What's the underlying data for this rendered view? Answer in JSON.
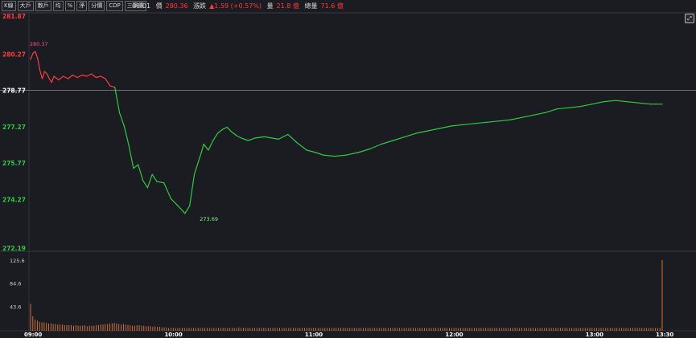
{
  "toolbar": {
    "buttons": [
      "K線",
      "大戶",
      "散戶",
      "均",
      "%",
      "淨",
      "分價",
      "CDP",
      "三筆價"
    ]
  },
  "info": {
    "time": "09:01",
    "price_label": "價",
    "price_value": "280.36",
    "change_label": "漲跌",
    "change_value": "▲1.59 (+0.57%)",
    "volume_label": "量",
    "volume_value": "21.8 億",
    "total_volume_label": "總量",
    "total_volume_value": "71.6 億"
  },
  "colors": {
    "up": "#ff3b3b",
    "down": "#2ecc40",
    "reference": "#ffffff",
    "volume": "#e07a3a",
    "high_label": "#ff4fa0",
    "low_label": "#7dff7d"
  },
  "icons": {
    "zoom": "expand-icon"
  },
  "chart_data": [
    {
      "type": "line",
      "reference_price": 278.77,
      "ylim": [
        272.19,
        281.87
      ],
      "y_ticks": [
        "281.87",
        "280.27",
        "278.77",
        "277.27",
        "275.77",
        "274.27",
        "272.19"
      ],
      "x_ticks": [
        "09:00",
        "10:00",
        "11:00",
        "12:00",
        "13:00",
        "13:30"
      ],
      "annotations": [
        {
          "text": "280.37",
          "x": "09:01",
          "y": 280.37
        },
        {
          "text": "273.69",
          "x": "10:13",
          "y": 273.69
        }
      ],
      "series": [
        {
          "x": [
            "09:00",
            "09:01",
            "09:02",
            "09:03",
            "09:04",
            "09:05",
            "09:06",
            "09:07",
            "09:08",
            "09:09",
            "09:10",
            "09:12",
            "09:14",
            "09:16",
            "09:18",
            "09:20",
            "09:22",
            "09:24",
            "09:26",
            "09:28",
            "09:30",
            "09:32",
            "09:34",
            "09:36",
            "09:38",
            "09:40",
            "09:42",
            "09:44",
            "09:46",
            "09:48",
            "09:50",
            "09:52",
            "09:54",
            "09:57",
            "10:00",
            "10:03",
            "10:06",
            "10:08",
            "10:10",
            "10:12",
            "10:13",
            "10:14",
            "10:16",
            "10:18",
            "10:20",
            "10:22",
            "10:24",
            "10:26",
            "10:28",
            "10:30",
            "10:33",
            "10:36",
            "10:40",
            "10:43",
            "10:46",
            "10:50",
            "10:54",
            "10:58",
            "11:00",
            "11:02",
            "11:05",
            "11:10",
            "11:15",
            "11:20",
            "11:25",
            "11:30",
            "11:35",
            "11:40",
            "11:45",
            "11:50",
            "11:55",
            "12:00",
            "12:05",
            "12:10",
            "12:15",
            "12:20",
            "12:25",
            "12:30",
            "12:35",
            "12:40",
            "12:45",
            "12:50",
            "12:55",
            "13:00",
            "13:05",
            "13:10",
            "13:15",
            "13:20",
            "13:25",
            "13:27",
            "13:30"
          ],
          "values": [
            280.05,
            280.3,
            280.37,
            280.1,
            279.6,
            279.25,
            279.55,
            279.45,
            279.25,
            279.1,
            279.35,
            279.2,
            279.35,
            279.25,
            279.4,
            279.3,
            279.4,
            279.35,
            279.45,
            279.3,
            279.35,
            279.25,
            278.95,
            278.9,
            277.85,
            277.3,
            276.5,
            275.55,
            275.7,
            275.05,
            274.75,
            275.3,
            275.0,
            274.95,
            274.3,
            274.0,
            273.69,
            274.0,
            275.3,
            275.9,
            276.2,
            276.55,
            276.3,
            276.7,
            277.0,
            277.15,
            277.25,
            277.05,
            276.9,
            276.8,
            276.7,
            276.8,
            276.85,
            276.8,
            276.75,
            276.95,
            276.6,
            276.3,
            276.25,
            276.2,
            276.1,
            276.05,
            276.1,
            276.2,
            276.35,
            276.55,
            276.7,
            276.85,
            277.0,
            277.1,
            277.2,
            277.3,
            277.35,
            277.4,
            277.45,
            277.5,
            277.55,
            277.65,
            277.75,
            277.85,
            278.0,
            278.05,
            278.1,
            278.2,
            278.3,
            278.35,
            278.3,
            278.25,
            278.2,
            278.2,
            278.2
          ]
        }
      ]
    },
    {
      "type": "bar",
      "ylim": [
        0,
        125.6
      ],
      "y_ticks": [
        "125.6",
        "84.6",
        "43.6"
      ],
      "categories_note": "per-minute volume",
      "values": [
        48,
        26,
        20,
        18,
        16,
        15,
        15,
        14,
        13,
        13,
        12,
        12,
        11,
        11,
        11,
        10,
        10,
        10,
        10,
        9,
        10,
        9,
        9,
        9,
        10,
        8,
        9,
        9,
        9,
        10,
        10,
        11,
        11,
        12,
        12,
        13,
        13,
        14,
        13,
        12,
        11,
        12,
        11,
        10,
        10,
        9,
        9,
        10,
        10,
        9,
        9,
        8,
        8,
        8,
        7,
        8,
        7,
        7,
        6,
        6,
        6,
        5,
        5,
        5,
        5,
        5,
        5,
        5,
        5,
        5,
        5,
        5,
        5,
        5,
        5,
        5,
        5,
        5,
        5,
        5,
        5,
        5,
        5,
        5,
        5,
        5,
        5,
        5,
        5,
        5,
        5,
        5,
        6,
        5,
        5,
        5,
        5,
        5,
        5,
        5,
        5,
        5,
        5,
        5,
        5,
        5,
        5,
        5,
        5,
        5,
        5,
        5,
        5,
        5,
        5,
        5,
        5,
        5,
        5,
        5,
        5,
        5,
        5,
        5,
        5,
        5,
        5,
        5,
        5,
        5,
        5,
        5,
        5,
        5,
        5,
        5,
        5,
        5,
        5,
        5,
        5,
        5,
        5,
        5,
        5,
        5,
        5,
        5,
        5,
        5,
        5,
        5,
        5,
        5,
        5,
        5,
        5,
        5,
        5,
        5,
        5,
        5,
        5,
        5,
        5,
        5,
        5,
        5,
        5,
        5,
        5,
        5,
        5,
        5,
        5,
        5,
        5,
        5,
        5,
        5,
        5,
        5,
        5,
        5,
        5,
        5,
        5,
        5,
        5,
        5,
        5,
        5,
        5,
        5,
        5,
        5,
        5,
        5,
        5,
        5,
        5,
        5,
        5,
        5,
        5,
        5,
        5,
        5,
        5,
        5,
        5,
        5,
        5,
        5,
        5,
        5,
        5,
        5,
        5,
        5,
        5,
        5,
        5,
        5,
        5,
        5,
        5,
        5,
        5,
        5,
        5,
        5,
        5,
        5,
        5,
        5,
        5,
        5,
        5,
        5,
        5,
        5,
        5,
        5,
        5,
        5,
        5,
        5,
        5,
        5,
        5,
        5,
        5,
        5,
        5,
        5,
        5,
        5,
        5,
        5,
        5,
        5,
        5,
        5,
        5,
        5,
        5,
        5,
        5,
        5,
        5,
        5,
        5,
        5,
        5,
        5,
        5,
        5,
        5,
        126
      ]
    }
  ]
}
